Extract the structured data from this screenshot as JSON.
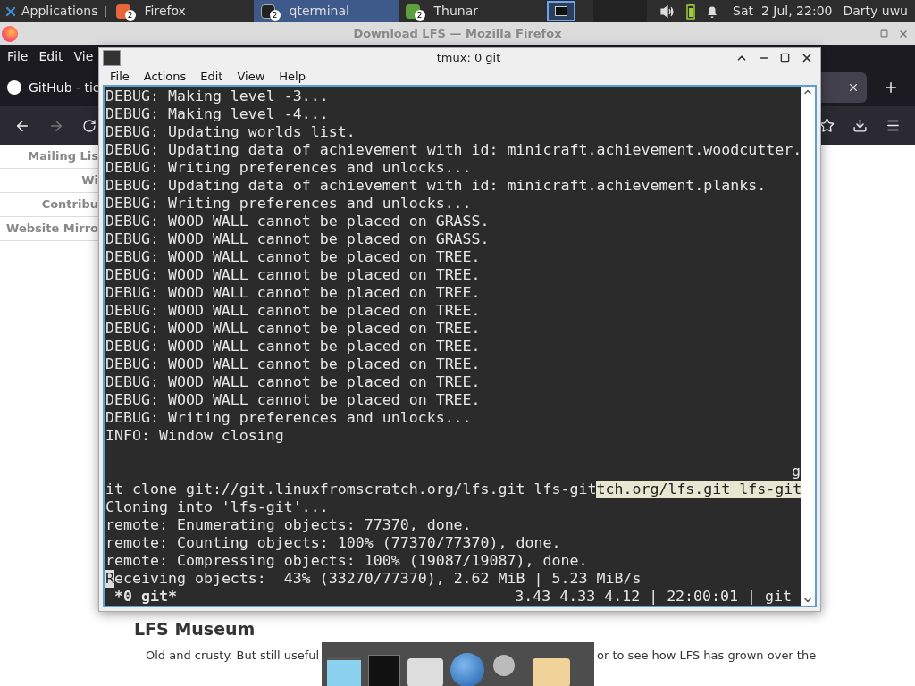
{
  "panel": {
    "apps_menu": "Applications",
    "tasks": [
      {
        "label": "Firefox",
        "count": "2",
        "selected": false
      },
      {
        "label": "qterminal",
        "count": "2",
        "selected": true
      },
      {
        "label": "Thunar",
        "count": "2",
        "selected": false
      }
    ],
    "clock": "Sat  2 Jul, 22:00",
    "user": "Darty uwu"
  },
  "firefox": {
    "title": "Download LFS — Mozilla Firefox",
    "menu": [
      "File",
      "Edit",
      "Vie"
    ],
    "tab": "GitHub - tie",
    "sidebar": [
      "Mailing Lis",
      "Wi",
      "Contribu",
      "Website Mirro"
    ],
    "heading": "LFS Museum",
    "paragraph": [
      "Old and crusty. But still useful",
      "or to see how LFS has grown over the"
    ]
  },
  "terminal": {
    "title": "tmux: 0 git",
    "menu": [
      "File",
      "Actions",
      "Edit",
      "View",
      "Help"
    ],
    "lines": [
      {
        "kind": "plain",
        "text": "DEBUG: Making level -3..."
      },
      {
        "kind": "plain",
        "text": "DEBUG: Making level -4..."
      },
      {
        "kind": "plain",
        "text": "DEBUG: Updating worlds list."
      },
      {
        "kind": "plain",
        "text": "DEBUG: Updating data of achievement with id: minicraft.achievement.woodcutter."
      },
      {
        "kind": "plain",
        "text": "DEBUG: Writing preferences and unlocks..."
      },
      {
        "kind": "plain",
        "text": "DEBUG: Updating data of achievement with id: minicraft.achievement.planks."
      },
      {
        "kind": "plain",
        "text": "DEBUG: Writing preferences and unlocks..."
      },
      {
        "kind": "plain",
        "text": "DEBUG: WOOD WALL cannot be placed on GRASS."
      },
      {
        "kind": "plain",
        "text": "DEBUG: WOOD WALL cannot be placed on GRASS."
      },
      {
        "kind": "plain",
        "text": "DEBUG: WOOD WALL cannot be placed on TREE."
      },
      {
        "kind": "plain",
        "text": "DEBUG: WOOD WALL cannot be placed on TREE."
      },
      {
        "kind": "plain",
        "text": "DEBUG: WOOD WALL cannot be placed on TREE."
      },
      {
        "kind": "plain",
        "text": "DEBUG: WOOD WALL cannot be placed on TREE."
      },
      {
        "kind": "plain",
        "text": "DEBUG: WOOD WALL cannot be placed on TREE."
      },
      {
        "kind": "plain",
        "text": "DEBUG: WOOD WALL cannot be placed on TREE."
      },
      {
        "kind": "plain",
        "text": "DEBUG: WOOD WALL cannot be placed on TREE."
      },
      {
        "kind": "plain",
        "text": "DEBUG: WOOD WALL cannot be placed on TREE."
      },
      {
        "kind": "plain",
        "text": "DEBUG: WOOD WALL cannot be placed on TREE."
      },
      {
        "kind": "plain",
        "text": "DEBUG: Writing preferences and unlocks..."
      },
      {
        "kind": "plain",
        "text": "INFO: Window closing"
      },
      {
        "kind": "blank"
      },
      {
        "kind": "right",
        "text": "g"
      },
      {
        "kind": "selection",
        "text": "it clone git://git.linuxfromscratch.org/lfs.git lfs-git",
        "selected_text": "tch.org/lfs.git lfs-git"
      },
      {
        "kind": "plain",
        "text": "Cloning into 'lfs-git'..."
      },
      {
        "kind": "plain",
        "text": "remote: Enumerating objects: 77370, done."
      },
      {
        "kind": "plain",
        "text": "remote: Counting objects: 100% (77370/77370), done."
      },
      {
        "kind": "plain",
        "text": "remote: Compressing objects: 100% (19087/19087), done."
      },
      {
        "kind": "cursor",
        "cursor": "R",
        "text": "eceiving objects:  43% (33270/77370), 2.62 MiB | 5.23 MiB/s"
      }
    ],
    "status_left": "*0 git*",
    "status_right": "3.43 4.33 4.12 | 22:00:01 | git"
  }
}
